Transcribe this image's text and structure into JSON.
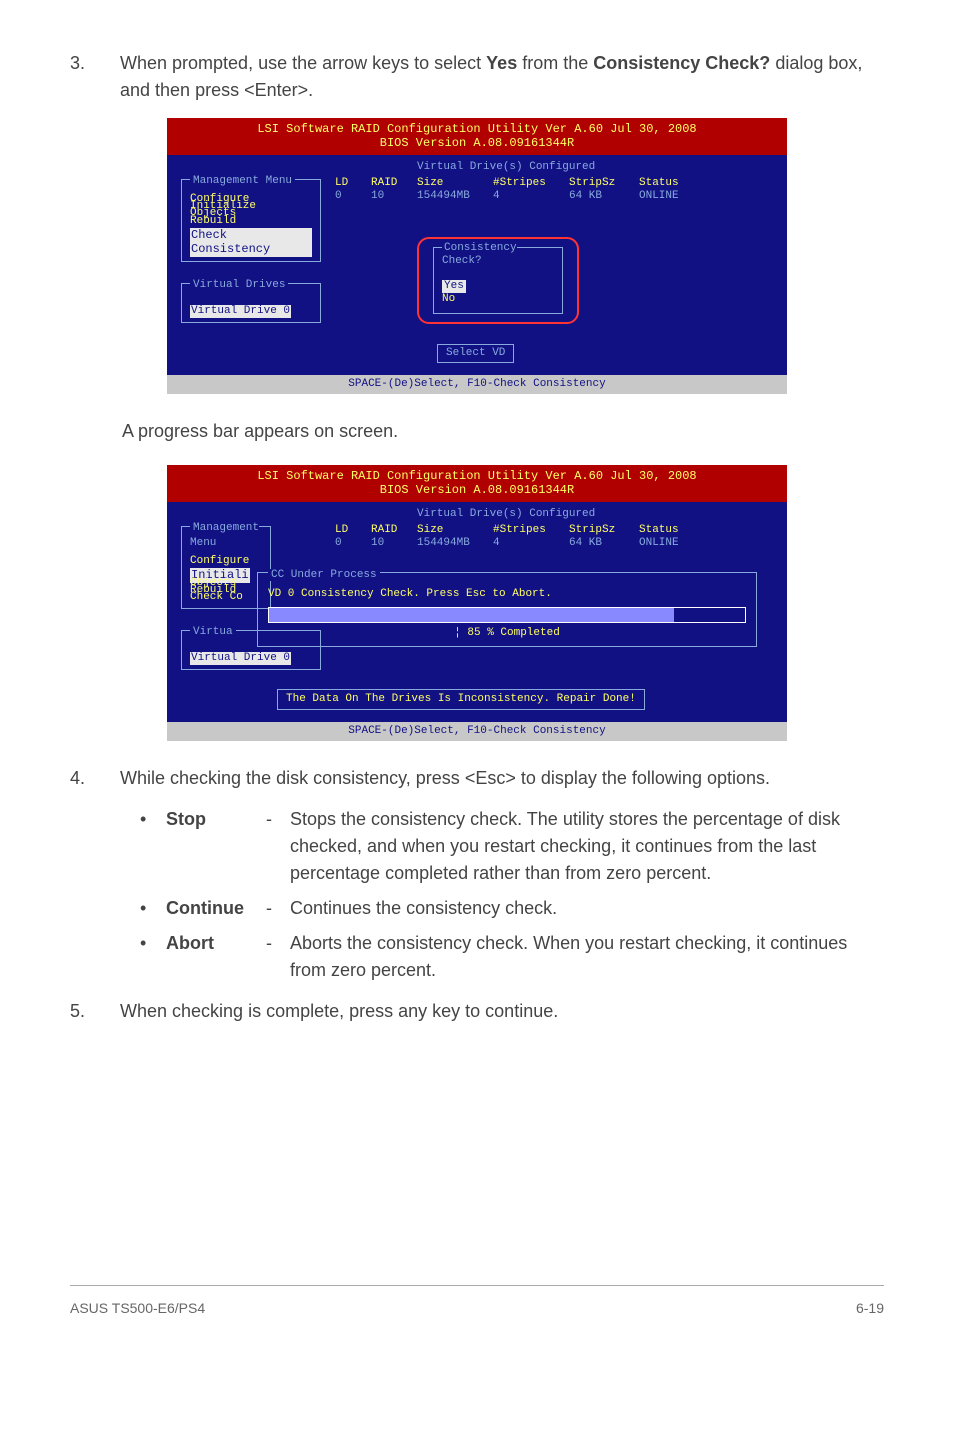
{
  "step3": {
    "num": "3.",
    "text_a": "When prompted, use the arrow keys to select ",
    "yes": "Yes",
    "text_b": " from the ",
    "cc": "Consistency Check?",
    "text_c": " dialog box, and then press <Enter>."
  },
  "bios1": {
    "title": "LSI Software RAID Configuration Utility Ver A.60 Jul 30, 2008",
    "subtitle": "BIOS Version  A.08.09161344R",
    "menu_title": "Management Menu",
    "menu": [
      "Configure",
      "Initialize",
      "Objects",
      "Rebuild"
    ],
    "menu_sel": "Check Consistency",
    "vd_title": "Virtual Drives",
    "vd_item": "Virtual Drive 0",
    "cfg_title": "Virtual Drive(s) Configured",
    "hdr": {
      "ld": "LD",
      "raid": "RAID",
      "size": "Size",
      "stripes": "#Stripes",
      "stripsz": "StripSz",
      "status": "Status"
    },
    "row": {
      "ld": "0",
      "raid": "10",
      "size": "154494MB",
      "stripes": "4",
      "stripsz": "64 KB",
      "status": "ONLINE"
    },
    "dlg_title": "Consistency Check?",
    "dlg_yes": "Yes",
    "dlg_no": "No",
    "select_vd": "Select VD",
    "footer": "SPACE-(De)Select,   F10-Check Consistency"
  },
  "subA": "A progress bar appears on screen.",
  "bios2": {
    "title": "LSI Software RAID Configuration Utility Ver A.60 Jul 30, 2008",
    "subtitle": "BIOS Version  A.08.09161344R",
    "menu_title": "Management Menu",
    "menu": [
      "Configure",
      "Initiali",
      "Objects",
      "Rebuild",
      "Check Co"
    ],
    "vd_title": "Virtua",
    "vd_item": "Virtual Drive 0",
    "cfg_title": "Virtual Drive(s) Configured",
    "hdr": {
      "ld": "LD",
      "raid": "RAID",
      "size": "Size",
      "stripes": "#Stripes",
      "stripsz": "StripSz",
      "status": "Status"
    },
    "row": {
      "ld": "0",
      "raid": "10",
      "size": "154494MB",
      "stripes": "4",
      "stripsz": "64 KB",
      "status": "ONLINE"
    },
    "prog_title": "CC Under Process",
    "prog_text": "VD 0 Consistency Check. Press Esc to Abort.",
    "prog_pct": "¦ 85 % Completed",
    "repair": "The Data On The Drives Is Inconsistency. Repair Done!",
    "footer": "SPACE-(De)Select,   F10-Check Consistency"
  },
  "step4": {
    "num": "4.",
    "text": "While checking the disk consistency, press <Esc> to display the following options."
  },
  "opts": [
    {
      "bullet": "•",
      "name": "Stop",
      "dash": "-",
      "text": "Stops the consistency check. The utility stores the percentage of disk checked, and when you restart checking, it continues from the last percentage completed rather than from zero percent."
    },
    {
      "bullet": "•",
      "name": "Continue",
      "dash": "-",
      "text": "Continues the consistency check."
    },
    {
      "bullet": "•",
      "name": "Abort",
      "dash": "-",
      "text": "Aborts the consistency check. When you restart checking, it continues from zero percent."
    }
  ],
  "step5": {
    "num": "5.",
    "text": "When checking is complete, press any key to continue."
  },
  "footer": {
    "left": "ASUS TS500-E6/PS4",
    "right": "6-19"
  }
}
